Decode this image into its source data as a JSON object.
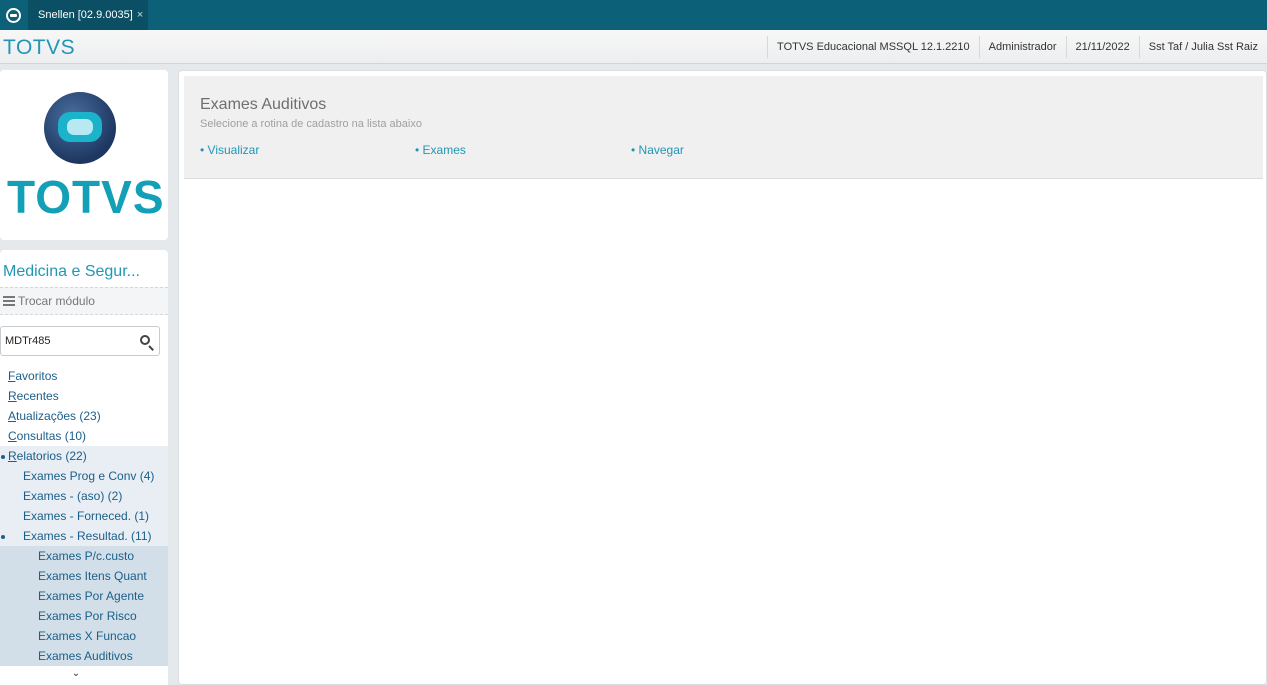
{
  "tabbar": {
    "tab_label": "Snellen [02.9.0035]",
    "tab_close": "×"
  },
  "header": {
    "brand": "TOTVS",
    "info": [
      "TOTVS Educacional MSSQL 12.1.2210",
      "Administrador",
      "21/11/2022",
      "Sst Taf / Julia Sst Raiz"
    ]
  },
  "sidebar": {
    "logo_text": "TOTVS",
    "module_title": "Medicina e Segur...",
    "switch_label": "Trocar módulo",
    "search_value": "MDTr485",
    "menu": [
      {
        "first": "F",
        "rest": "avoritos"
      },
      {
        "first": "R",
        "rest": "ecentes"
      },
      {
        "first": "A",
        "rest": "tualizações (23)"
      },
      {
        "first": "C",
        "rest": "onsultas (10)"
      },
      {
        "first": "R",
        "rest": "elatorios (22)"
      }
    ],
    "submenu": [
      "Exames Prog e Conv (4)",
      "Exames - (aso) (2)",
      "Exames - Forneced. (1)",
      "Exames - Resultad. (11)"
    ],
    "subsubmenu": [
      "Exames P/c.custo",
      "Exames Itens Quant",
      "Exames Por Agente",
      "Exames Por Risco",
      "Exames X Funcao",
      "Exames Auditivos"
    ],
    "scroll_chevron": "⌄"
  },
  "main": {
    "title": "Exames Auditivos",
    "subtitle": "Selecione a rotina de cadastro na lista abaixo",
    "links": [
      "• Visualizar",
      "• Exames",
      "• Navegar"
    ]
  },
  "colors": {
    "tabbar": "#0c6179",
    "accent": "#2196b6",
    "menu_text": "#1a5f8a",
    "logo_teal": "#13a0b6"
  }
}
